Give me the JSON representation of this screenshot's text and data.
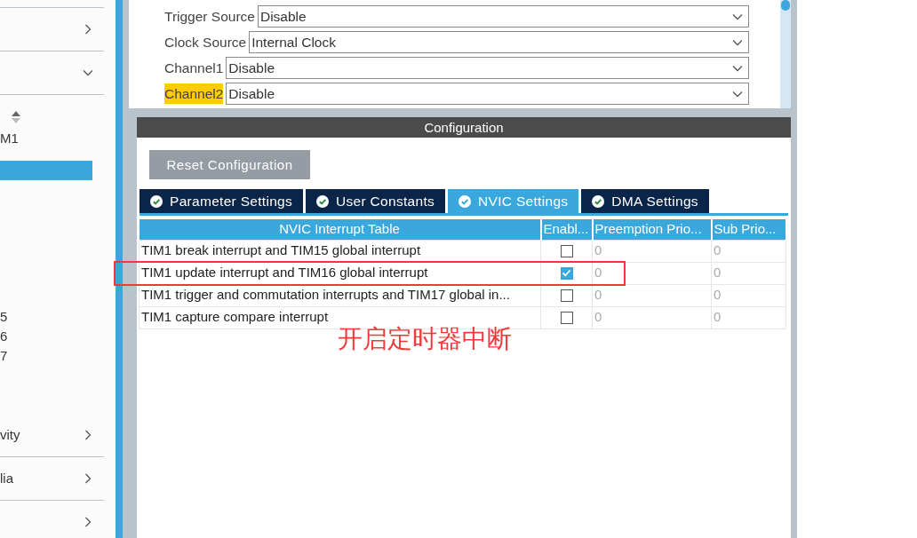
{
  "sidebar": {
    "top_sections": [
      {
        "expanded": false
      },
      {
        "expanded": true
      }
    ],
    "items": [
      {
        "label": "M1",
        "selected": false
      },
      {
        "selected": true
      }
    ],
    "more_items": [
      {
        "label": "5"
      },
      {
        "label": "6"
      },
      {
        "label": "7"
      }
    ],
    "bottom_sections": [
      {
        "label": "vity",
        "expanded": false
      },
      {
        "label": "lia",
        "expanded": false
      },
      {
        "expanded": false
      }
    ]
  },
  "mode_fields": [
    {
      "label": "Trigger Source",
      "value": "Disable",
      "highlighted": false
    },
    {
      "label": "Clock Source",
      "value": "Internal Clock",
      "highlighted": false
    },
    {
      "label": "Channel1",
      "value": "Disable",
      "highlighted": false
    },
    {
      "label": "Channel2",
      "value": "Disable",
      "highlighted": true
    }
  ],
  "configuration": {
    "title": "Configuration",
    "reset_button": "Reset Configuration",
    "tabs": [
      {
        "label": "Parameter Settings",
        "selected": false
      },
      {
        "label": "User Constants",
        "selected": false
      },
      {
        "label": "NVIC Settings",
        "selected": true
      },
      {
        "label": "DMA Settings",
        "selected": false
      }
    ],
    "table": {
      "columns": [
        "NVIC Interrupt Table",
        "Enabl...",
        "Preemption Prio...",
        "Sub Prio..."
      ],
      "rows": [
        {
          "name": "TIM1 break interrupt and TIM15 global interrupt",
          "enabled": false,
          "preemption": "0",
          "sub": "0"
        },
        {
          "name": "TIM1 update interrupt and TIM16 global interrupt",
          "enabled": true,
          "circled": true,
          "preemption": "0",
          "sub": "0"
        },
        {
          "name": "TIM1 trigger and commutation interrupts and TIM17 global in...",
          "enabled": false,
          "preemption": "0",
          "sub": "0"
        },
        {
          "name": "TIM1 capture compare interrupt",
          "enabled": false,
          "preemption": "0",
          "sub": "0"
        }
      ]
    }
  },
  "annotations": [
    {
      "kind": "highlight-box"
    },
    {
      "kind": "note",
      "text": "开启定时器中断"
    }
  ]
}
